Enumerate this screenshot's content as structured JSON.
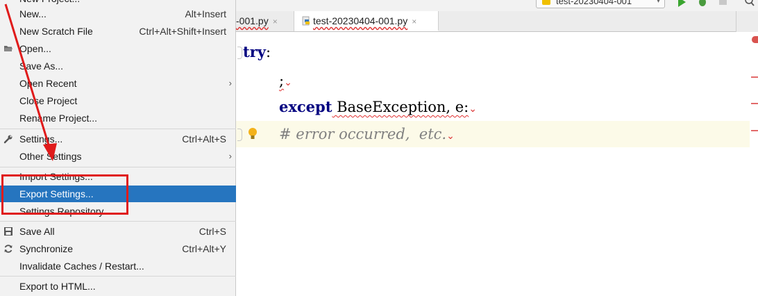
{
  "menu": {
    "top_cut_label": "New Project...",
    "items": [
      {
        "label": "New...",
        "shortcut": "Alt+Insert",
        "mnemonic": "N"
      },
      {
        "label": "New Scratch File",
        "shortcut": "Ctrl+Alt+Shift+Insert"
      },
      {
        "label": "Open...",
        "icon": "folder-icon"
      },
      {
        "label": "Save As..."
      },
      {
        "label": "Open Recent",
        "submenu": true
      },
      {
        "label": "Close Project"
      },
      {
        "label": "Rename Project..."
      },
      {
        "label": "Settings...",
        "shortcut": "Ctrl+Alt+S",
        "icon": "wrench-icon"
      },
      {
        "label": "Other Settings",
        "submenu": true
      },
      {
        "label": "Import Settings..."
      },
      {
        "label": "Export Settings...",
        "selected": true
      },
      {
        "label": "Settings Repository..."
      },
      {
        "label": "Save All",
        "shortcut": "Ctrl+S",
        "icon": "save-icon"
      },
      {
        "label": "Synchronize",
        "shortcut": "Ctrl+Alt+Y",
        "icon": "sync-icon"
      },
      {
        "label": "Invalidate Caches / Restart..."
      },
      {
        "label": "Export to HTML..."
      }
    ],
    "submenu_arrow": "›"
  },
  "toolbar": {
    "run_config": "test-20230404-001",
    "run_config_arrow": "▾"
  },
  "tabs": [
    {
      "label": "-001.py",
      "close": "×"
    },
    {
      "label": "test-20230404-001.py",
      "close": "×",
      "active": true
    }
  ],
  "editor": {
    "lines": [
      {
        "kw": "try",
        "rest": ":"
      },
      {
        "text": ";",
        "tail": "⌄"
      },
      {
        "kw": "except",
        "rest": " BaseException, e:",
        "tail": "⌄"
      },
      {
        "comment": "# error occurred,  etc.",
        "tail": "⌄"
      }
    ]
  },
  "colors": {
    "selection": "#2675bf",
    "annotation": "#e01b1b",
    "keyword": "#000080",
    "comment": "#808080"
  }
}
